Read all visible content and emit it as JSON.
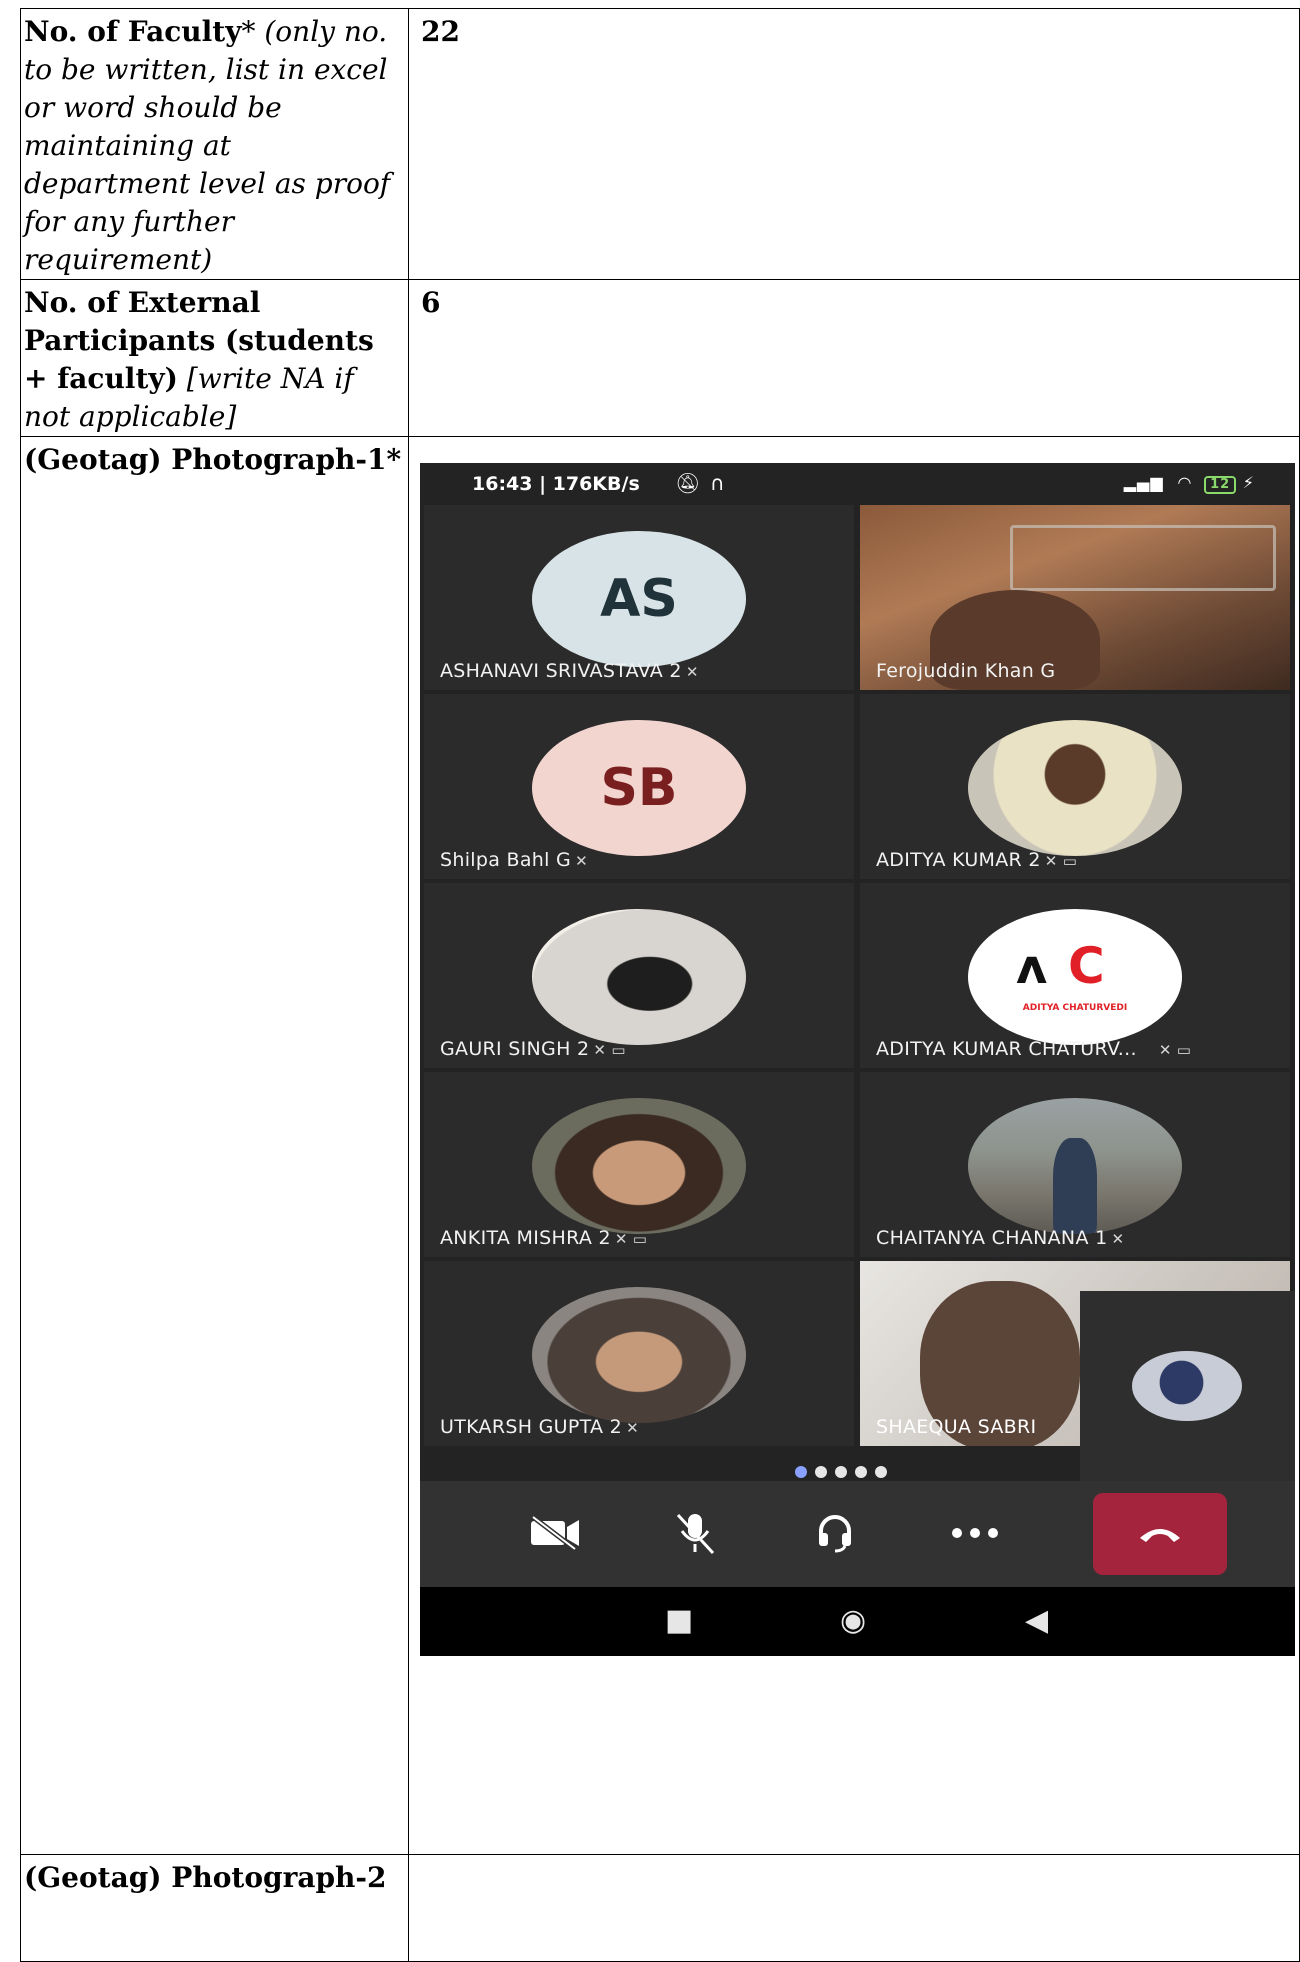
{
  "rows": {
    "faculty": {
      "label_bold": "No. of Faculty",
      "label_star": "*",
      "label_italic": " (only no. to be written, list in excel or word should be maintaining at department level as proof for any further requirement)",
      "value": "22"
    },
    "external": {
      "label_bold": "No. of External Participants (students + faculty)",
      "label_italic": " [write NA if not applicable]",
      "value": "6"
    },
    "photo1": {
      "label": "(Geotag) Photograph-1*"
    },
    "photo2": {
      "label": "(Geotag) Photograph-2"
    }
  },
  "phone": {
    "status_time": "16:43 | 176KB/s",
    "battery": "12",
    "participants": [
      {
        "name": "ASHANAVI SRIVASTAVA 2",
        "initials": "AS"
      },
      {
        "name": "Ferojuddin Khan G"
      },
      {
        "name": "Shilpa Bahl G",
        "initials": "SB"
      },
      {
        "name": "ADITYA KUMAR 2"
      },
      {
        "name": "GAURI SINGH 2"
      },
      {
        "name": "ADITYA KUMAR CHATURV..."
      },
      {
        "name": "ANKITA MISHRA 2"
      },
      {
        "name": "CHAITANYA  CHANANA 1"
      },
      {
        "name": "UTKARSH GUPTA 2"
      },
      {
        "name": "SHAEQUA SABRI"
      }
    ],
    "logo_text": "ADITYA CHATURVEDI",
    "page_dots": 5,
    "active_dot": 0
  },
  "colors": {
    "as_avatar_bg": "#d7e3e6",
    "sb_avatar_bg": "#f2d5cf",
    "hangup": "#a5243d",
    "logo_accent": "#e01f26"
  }
}
